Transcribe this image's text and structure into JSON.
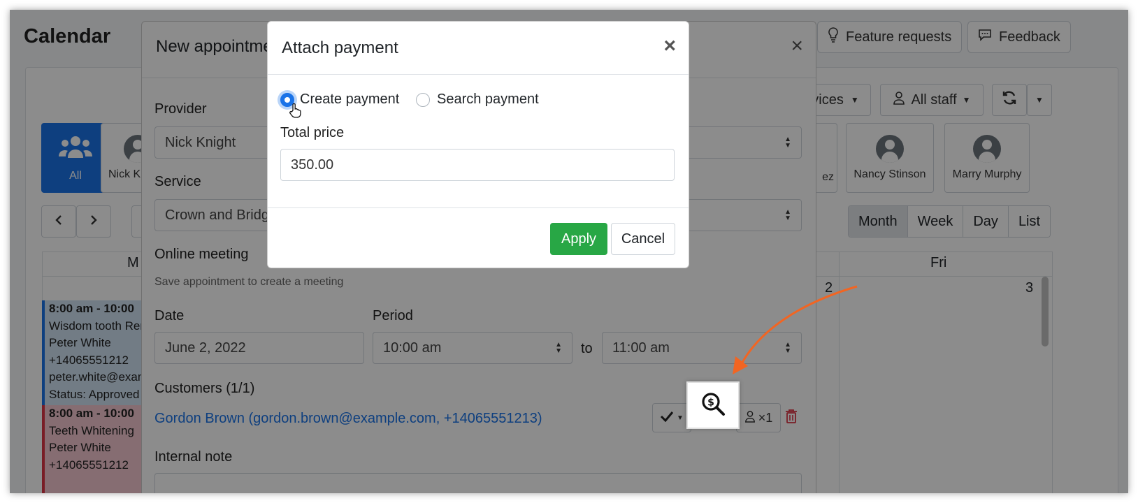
{
  "background": {
    "app_title": "Calendar",
    "top_buttons": {
      "feature_requests": "Feature requests",
      "feedback": "Feedback"
    },
    "filters": {
      "services": "vices",
      "all_staff": "All staff"
    },
    "staff": [
      {
        "name": "All"
      },
      {
        "name": "Nick K"
      },
      {
        "name": "ez"
      },
      {
        "name": "Nancy Stinson"
      },
      {
        "name": "Marry Murphy"
      }
    ],
    "view_tabs": [
      "Month",
      "Week",
      "Day",
      "List"
    ],
    "active_view": "Month",
    "calendar": {
      "col_mon_partial": "M",
      "col_fri": "Fri",
      "day_2": "2",
      "day_3": "3",
      "events": [
        {
          "time": "8:00 am - 10:00",
          "service": "Wisdom tooth Rer",
          "customer": "Peter White",
          "phone": "+14065551212",
          "email": "peter.white@exam",
          "status": "Status: Approved"
        },
        {
          "time": "8:00 am - 10:00",
          "service": "Teeth Whitening",
          "customer": "Peter White",
          "phone": "+14065551212"
        }
      ]
    }
  },
  "appointment_modal": {
    "title": "New appointme",
    "provider_label": "Provider",
    "provider_value": "Nick Knight",
    "service_label": "Service",
    "service_value": "Crown and Bridg",
    "online_meeting_label": "Online meeting",
    "online_meeting_note": "Save appointment to create a meeting",
    "date_label": "Date",
    "date_value": "June 2, 2022",
    "period_label": "Period",
    "period_from": "10:00 am",
    "period_to_word": "to",
    "period_to": "11:00 am",
    "customers_label": "Customers (1/1)",
    "customer_link": "Gordon Brown (gordon.brown@example.com, +14065551213)",
    "customer_count": "×1",
    "internal_note_label": "Internal note"
  },
  "payment_modal": {
    "title": "Attach payment",
    "close_symbol": "×",
    "radio_create": "Create payment",
    "radio_search": "Search payment",
    "total_price_label": "Total price",
    "total_price_value": "350.00",
    "apply_label": "Apply",
    "cancel_label": "Cancel"
  },
  "colors": {
    "accent": "#1a73e8",
    "apply": "#28a745",
    "arrow": "#f26522",
    "delete": "#dc3545"
  }
}
